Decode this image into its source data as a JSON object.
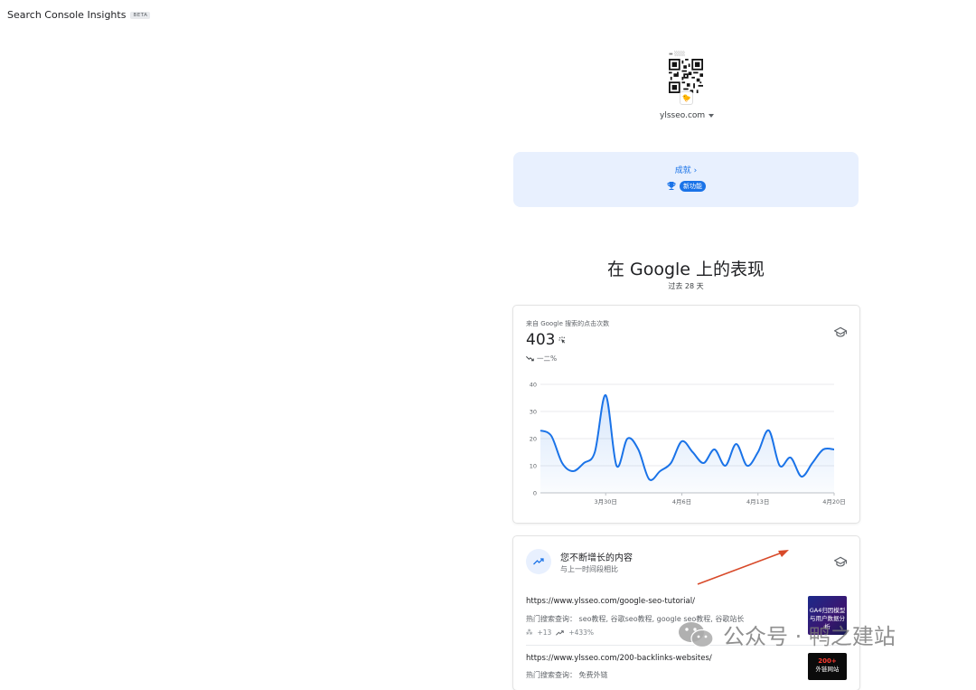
{
  "app": {
    "title": "Search Console Insights",
    "beta": "BETA"
  },
  "property": {
    "name": "ylsseo.com"
  },
  "achievements": {
    "link": "成就",
    "badge": "新功能"
  },
  "performance": {
    "title": "在 Google 上的表现",
    "period": "过去 28 天"
  },
  "clicks_card": {
    "label": "来自 Google 搜索的点击次数",
    "value": "403",
    "change": "一二%"
  },
  "growing_card": {
    "title": "您不断增长的内容",
    "subtitle": "与上一时间段相比",
    "items": [
      {
        "url": "https://www.ylsseo.com/google-seo-tutorial/",
        "queries": "热门搜索查询：  seo教程, 谷歌seo教程, google seo教程, 谷歌站长",
        "clicks": "+13",
        "growth": "+433%",
        "thumb_text": "GA4归因模型与用户数据分析"
      },
      {
        "url": "https://www.ylsseo.com/200-backlinks-websites/",
        "queries": "热门搜索查询：  免费外链",
        "thumb_text_1": "200+",
        "thumb_text_2": "外链网站"
      }
    ]
  },
  "watermark": {
    "text": "公众号 · 鸭之建站"
  },
  "colors": {
    "accent": "#1a73e8",
    "achievement_bg": "#e8f0fe",
    "arrow": "#d84a2a"
  },
  "chart_data": {
    "type": "area",
    "ylim": [
      0,
      40
    ],
    "yticks": [
      "0",
      "10",
      "20",
      "30",
      "40"
    ],
    "x_tick_labels": [
      {
        "index": 6,
        "label": "3月30日"
      },
      {
        "index": 13,
        "label": "4月6日"
      },
      {
        "index": 20,
        "label": "4月13日"
      },
      {
        "index": 27,
        "label": "4月20日"
      }
    ],
    "series": [
      {
        "values": [
          23,
          21,
          11,
          8,
          11,
          15,
          36,
          10,
          20,
          16,
          5,
          8,
          11,
          19,
          15,
          11,
          16,
          10,
          18,
          10,
          15,
          23,
          10,
          13,
          6,
          11,
          16,
          16
        ]
      }
    ]
  }
}
